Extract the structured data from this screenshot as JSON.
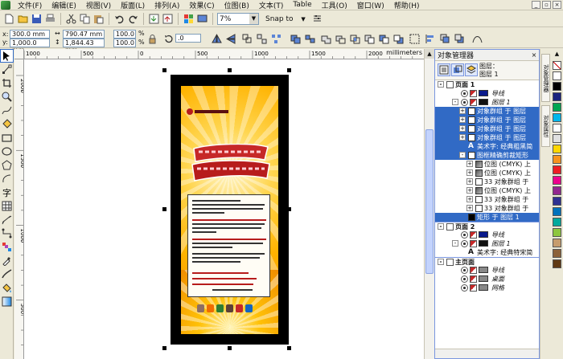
{
  "menu": [
    "文件(F)",
    "编辑(E)",
    "视图(V)",
    "版面(L)",
    "排列(A)",
    "效果(C)",
    "位图(B)",
    "文本(T)",
    "Table",
    "工具(O)",
    "窗口(W)",
    "帮助(H)"
  ],
  "toolbar": {
    "zoom_value": "7%",
    "snap_label": "Snap to"
  },
  "property_bar": {
    "x": "300.0 mm",
    "y": "1,000.0 mm",
    "width": "790.47 mm",
    "height": "1,844.43 mm",
    "scale_x": "100.0",
    "scale_y": "100.0",
    "pct_x": "%",
    "pct_y": "%",
    "rotation": ".0"
  },
  "ruler": {
    "unit": "millimeters",
    "h_ticks": [
      "1000",
      "500",
      "0",
      "500",
      "1000",
      "1500",
      "2000"
    ],
    "v_ticks": [
      "2000",
      "1500",
      "1000",
      "500"
    ]
  },
  "docker": {
    "title": "对象管理器",
    "info_line1": "图层：",
    "info_line2": "图层 1",
    "rows": [
      {
        "indent": 0,
        "exp": "-",
        "icon": "page",
        "label": "页面 1",
        "kind": "page"
      },
      {
        "indent": 2,
        "exp": "",
        "icon": "eye",
        "swatch": "#0a1a8c",
        "label": "导线",
        "kind": "layer"
      },
      {
        "indent": 2,
        "exp": "-",
        "icon": "eye",
        "swatch": "#111111",
        "label": "图层 1",
        "kind": "layer"
      },
      {
        "indent": 3,
        "exp": "+",
        "icon": "group",
        "label": "对象群组 于 图层",
        "kind": "sel"
      },
      {
        "indent": 3,
        "exp": "+",
        "icon": "group",
        "label": "对象群组 于 图层",
        "kind": "sel"
      },
      {
        "indent": 3,
        "exp": "+",
        "icon": "group",
        "label": "对象群组 于 图层",
        "kind": "sel"
      },
      {
        "indent": 3,
        "exp": "+",
        "icon": "group",
        "label": "对象群组 于 图层",
        "kind": "sel"
      },
      {
        "indent": 3,
        "exp": "",
        "icon": "text",
        "label": "美术字: 经典粗黑简",
        "kind": "sel"
      },
      {
        "indent": 3,
        "exp": "-",
        "icon": "rect",
        "label": "图框精确剪裁矩形",
        "kind": "sel"
      },
      {
        "indent": 4,
        "exp": "+",
        "icon": "bitmap",
        "label": "位图 (CMYK) 上",
        "kind": ""
      },
      {
        "indent": 4,
        "exp": "+",
        "icon": "bitmap",
        "label": "位图 (CMYK) 上",
        "kind": ""
      },
      {
        "indent": 4,
        "exp": "+",
        "icon": "group",
        "label": "33 对象群组 于",
        "kind": ""
      },
      {
        "indent": 4,
        "exp": "+",
        "icon": "bitmap",
        "label": "位图 (CMYK) 上",
        "kind": ""
      },
      {
        "indent": 4,
        "exp": "+",
        "icon": "group",
        "label": "33 对象群组 于",
        "kind": ""
      },
      {
        "indent": 4,
        "exp": "+",
        "icon": "group",
        "label": "33 对象群组 于",
        "kind": ""
      },
      {
        "indent": 3,
        "exp": "",
        "icon": "rectblack",
        "label": "矩形 于 图层 1",
        "kind": "sel"
      },
      {
        "indent": 0,
        "exp": "-",
        "icon": "page",
        "label": "页面 2",
        "kind": "page sep"
      },
      {
        "indent": 2,
        "exp": "",
        "icon": "eye",
        "swatch": "#0a1a8c",
        "label": "导线",
        "kind": "layer"
      },
      {
        "indent": 2,
        "exp": "-",
        "icon": "eye",
        "swatch": "#111111",
        "label": "图层 1",
        "kind": "layer"
      },
      {
        "indent": 3,
        "exp": "",
        "icon": "text",
        "label": "美术字: 经典特宋简",
        "kind": ""
      },
      {
        "indent": 0,
        "exp": "-",
        "icon": "page",
        "label": "主页面",
        "kind": "page sep"
      },
      {
        "indent": 2,
        "exp": "",
        "icon": "eye",
        "swatch": "#888888",
        "label": "导线",
        "kind": "layer"
      },
      {
        "indent": 2,
        "exp": "",
        "icon": "eye",
        "swatch": "#888888",
        "label": "桌面",
        "kind": "layer"
      },
      {
        "indent": 2,
        "exp": "",
        "icon": "eye",
        "swatch": "#888888",
        "label": "网格",
        "kind": "layer"
      }
    ]
  },
  "side_tabs": [
    "对象管理器",
    "对象属性"
  ],
  "palette": [
    "#ffffff",
    "#000000",
    "#1a237e",
    "#00a651",
    "#00b7eb",
    "#ffffff",
    "#e0e0e0",
    "#ffd600",
    "#f7931e",
    "#ed1c24",
    "#ec008c",
    "#92278f",
    "#2e3192",
    "#0072bc",
    "#00a99d",
    "#8dc63f",
    "#c69c6d",
    "#8c6239",
    "#603913"
  ]
}
